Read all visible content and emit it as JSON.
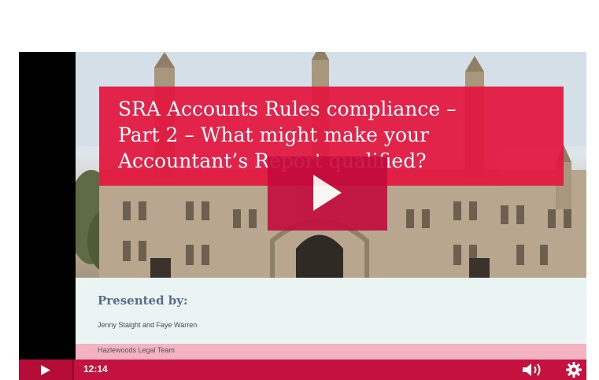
{
  "slide": {
    "title": "SRA Accounts Rules compliance –\nPart 2 – What might make your\nAccountant’s Report qualified?",
    "presented_by": "Presented by:",
    "presenters": "Jenny Staight and Faye Warren",
    "team": "Hazlewoods Legal Team"
  },
  "controls": {
    "time": "12:14"
  },
  "icons": {
    "big_play": "play-icon",
    "play": "play-icon",
    "volume": "volume-icon",
    "settings": "gear-icon"
  },
  "colors": {
    "accent": "#e3163f",
    "control_bar": "#c4113e",
    "team_bar": "#f3b3c3"
  }
}
